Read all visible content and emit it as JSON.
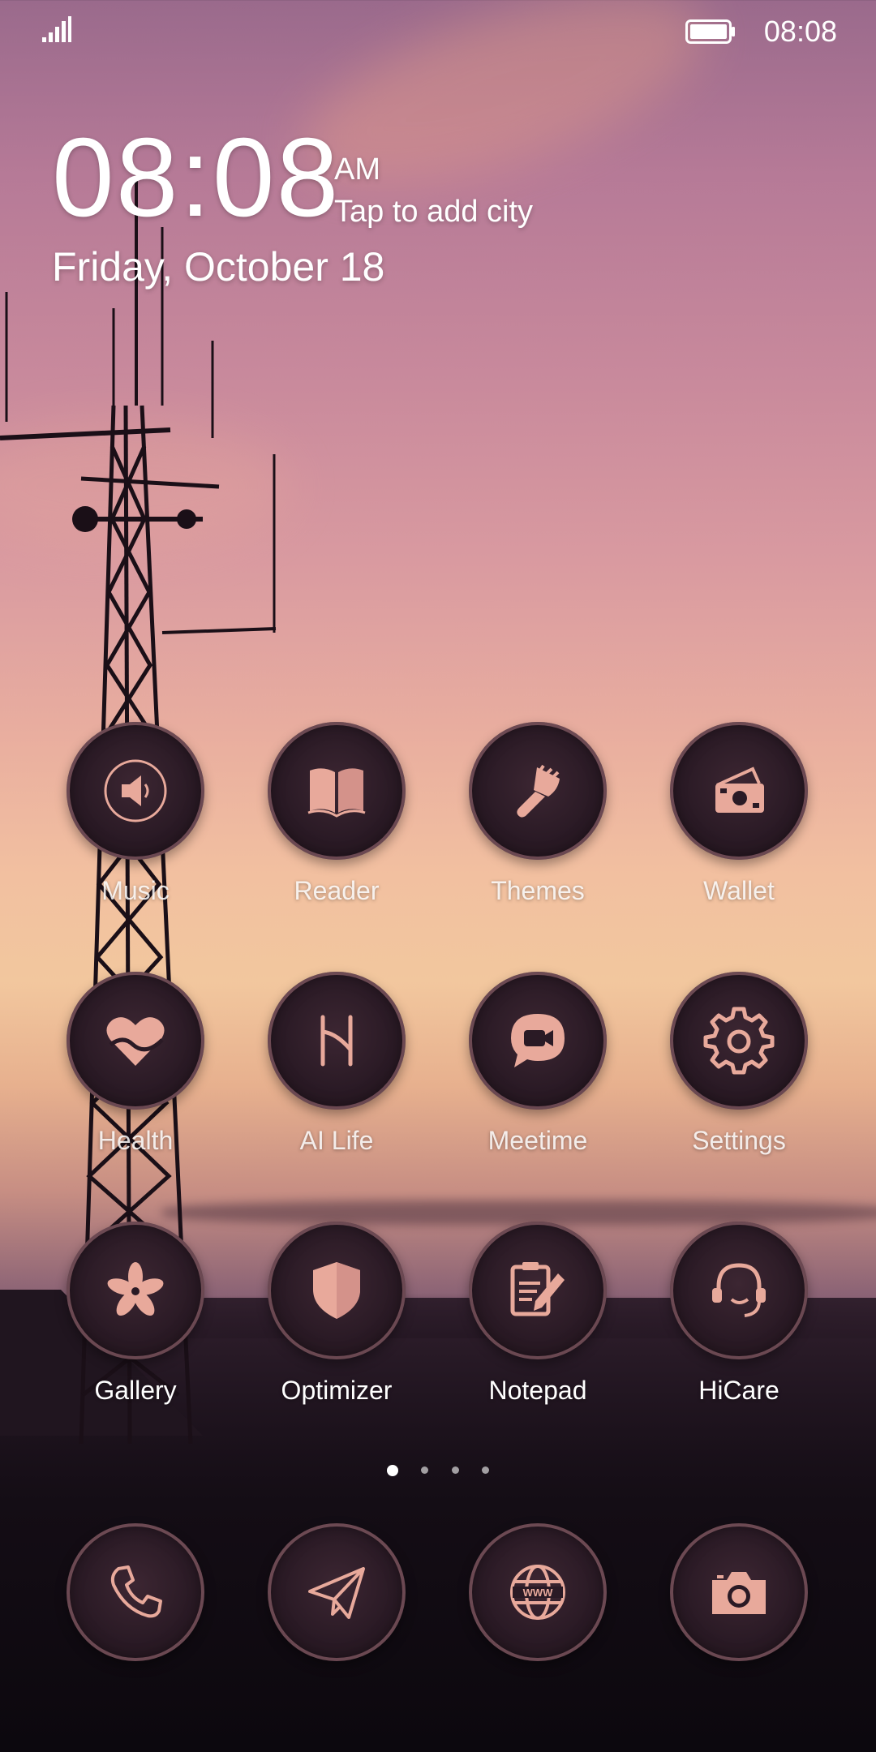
{
  "status_bar": {
    "time": "08:08",
    "signal_icon": "signal-icon",
    "battery_icon": "battery-icon"
  },
  "clock_widget": {
    "time": "08:08",
    "ampm": "AM",
    "city_prompt": "Tap to add city",
    "date": "Friday, October 18"
  },
  "apps": [
    {
      "label": "Music",
      "icon": "speaker-icon"
    },
    {
      "label": "Reader",
      "icon": "book-icon"
    },
    {
      "label": "Themes",
      "icon": "paintbrush-icon"
    },
    {
      "label": "Wallet",
      "icon": "wallet-icon"
    },
    {
      "label": "Health",
      "icon": "heart-icon"
    },
    {
      "label": "AI Life",
      "icon": "ai-life-icon"
    },
    {
      "label": "Meetime",
      "icon": "video-call-icon"
    },
    {
      "label": "Settings",
      "icon": "gear-icon"
    },
    {
      "label": "Gallery",
      "icon": "flower-icon"
    },
    {
      "label": "Optimizer",
      "icon": "shield-icon"
    },
    {
      "label": "Notepad",
      "icon": "notepad-icon"
    },
    {
      "label": "HiCare",
      "icon": "headset-icon"
    }
  ],
  "page_indicator": {
    "current": 1,
    "total": 4
  },
  "dock": [
    {
      "name": "phone",
      "icon": "phone-icon"
    },
    {
      "name": "messages",
      "icon": "paper-plane-icon"
    },
    {
      "name": "browser",
      "icon": "globe-icon"
    },
    {
      "name": "camera",
      "icon": "camera-icon"
    }
  ],
  "colors": {
    "icon_accent": "#e8a99b",
    "circle_bg": "#2a1a25"
  }
}
